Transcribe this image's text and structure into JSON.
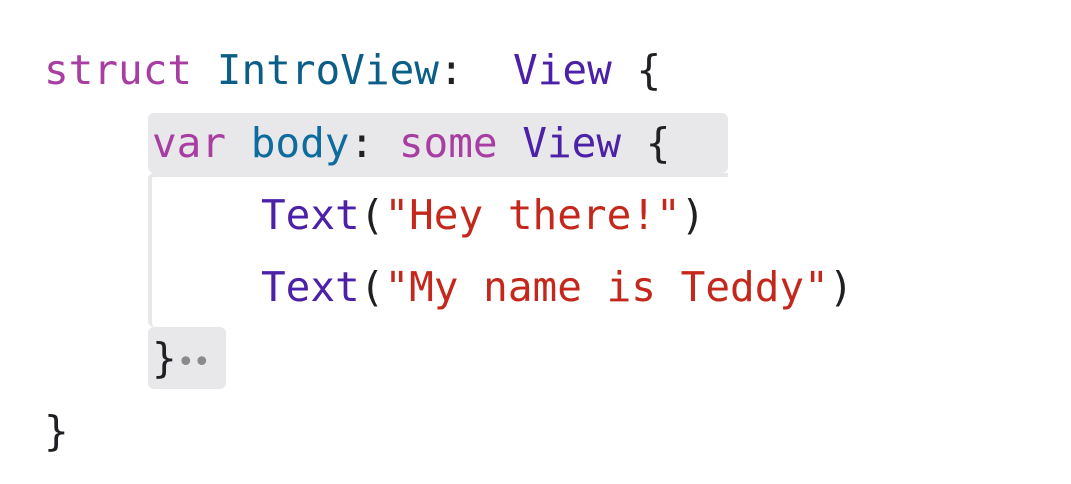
{
  "code": {
    "line1": {
      "keyword": "struct",
      "name": "IntroView",
      "colon": ":",
      "protocol": "View",
      "brace": "{"
    },
    "line2": {
      "keyword": "var",
      "name": "body",
      "colon": ":",
      "some": "some",
      "type": "View",
      "brace": "{"
    },
    "line3": {
      "call": "Text",
      "open": "(",
      "string": "\"Hey there!\"",
      "close": ")"
    },
    "line4": {
      "call": "Text",
      "open": "(",
      "string": "\"My name is Teddy\"",
      "close": ")"
    },
    "line5": {
      "brace": "}",
      "fold_indicator": "••"
    },
    "line6": {
      "brace": "}"
    }
  },
  "colors": {
    "keyword": "#a83da2",
    "type_declaration": "#0b5e86",
    "type_reference": "#4b21a8",
    "identifier": "#0e6b9e",
    "string": "#c4281c",
    "highlight": "#e8e8ea"
  }
}
